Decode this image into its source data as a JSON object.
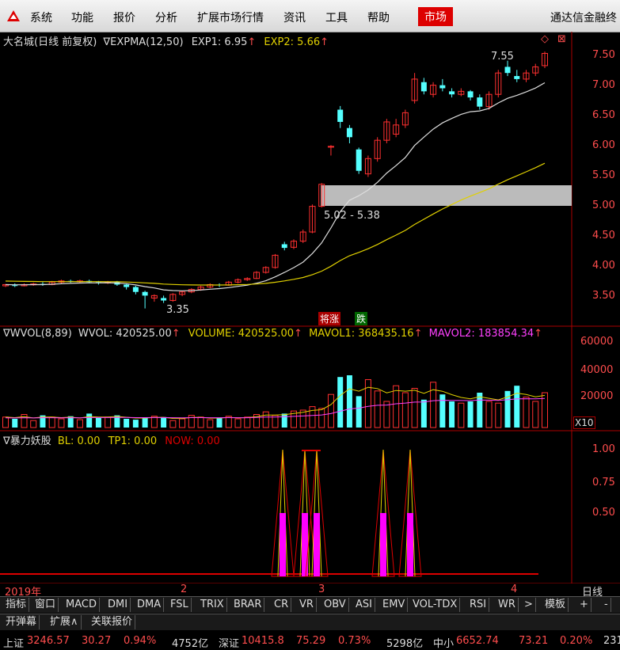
{
  "menu": {
    "items": [
      "系统",
      "功能",
      "报价",
      "分析",
      "扩展市场行情",
      "资讯",
      "工具",
      "帮助"
    ],
    "active": "市场",
    "brand": "通达信金融终"
  },
  "main_chart": {
    "title": "大名城(日线 前复权)",
    "indicator": "∇EXPMA(12,50)",
    "exp1": "EXP1: 6.95",
    "exp2": "EXP2: 5.66",
    "y_ticks": [
      "7.50",
      "7.00",
      "6.50",
      "6.00",
      "5.50",
      "5.00",
      "4.50",
      "4.00",
      "3.50"
    ],
    "high_label": "7.55",
    "low_label": "3.35",
    "zone_label": "5.02 - 5.38",
    "tag_zhang": "将涨",
    "tag_die": "跌"
  },
  "volume_chart": {
    "title": "∇WVOL(8,89)",
    "wvol": "WVOL: 420525.00",
    "volume": "VOLUME: 420525.00",
    "mavol1": "MAVOL1: 368435.16",
    "mavol2": "MAVOL2: 183854.34",
    "y_ticks": [
      "60000",
      "40000",
      "20000"
    ],
    "unit": "X10"
  },
  "signal_chart": {
    "title": "∇暴力妖股",
    "bl": "BL: 0.00",
    "tp1": "TP1: 0.00",
    "now": "NOW: 0.00",
    "y_ticks": [
      "1.00",
      "0.75",
      "0.50"
    ]
  },
  "date_axis": {
    "year": "2019年",
    "months": [
      "2",
      "3",
      "4"
    ],
    "period": "日线"
  },
  "tabs": [
    "指标",
    "窗口",
    "MACD",
    "DMI",
    "DMA",
    "FSL",
    "TRIX",
    "BRAR",
    "CR",
    "VR",
    "OBV",
    "ASI",
    "EMV",
    "VOL-TDX",
    "RSI",
    "WR",
    ">",
    "模板",
    "+",
    "-"
  ],
  "tabs2": [
    "开弹幕",
    "扩展∧",
    "关联报价"
  ],
  "status": {
    "sh_label": "上证",
    "sh_value": "3246.57",
    "sh_change": "30.27",
    "sh_pct": "0.94%",
    "sh_amount": "4752亿",
    "sz_label": "深证",
    "sz_value": "10415.8",
    "sz_change": "75.29",
    "sz_pct": "0.73%",
    "sz_amount": "5298亿",
    "zx_label": "中小",
    "zx_value": "6652.74",
    "zx_change": "73.21",
    "zx_pct": "0.20%",
    "tail": "231"
  },
  "colors": {
    "up": "#ff3030",
    "down": "#54ffff",
    "exp1": "#dddddd",
    "exp2": "#e0d000",
    "mavol2": "#ff40ff",
    "signal": "#ff00ff"
  }
}
